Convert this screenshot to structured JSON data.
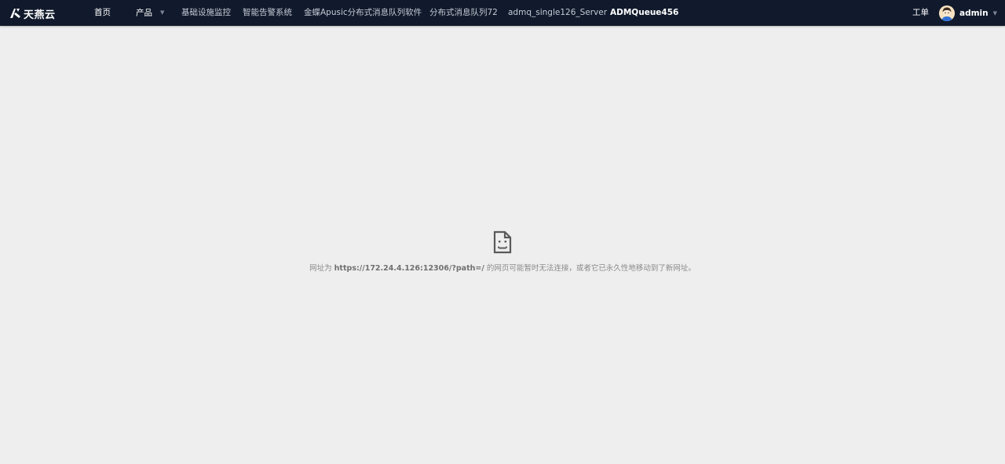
{
  "brand": {
    "name": "天燕云",
    "logo_icon": "tianyan-logo-icon"
  },
  "nav": {
    "items": [
      {
        "label": "首页"
      },
      {
        "label": "产品",
        "has_dropdown": true
      },
      {
        "label": "基础设施监控"
      },
      {
        "label": "智能告警系统"
      },
      {
        "label": "金蝶Apusic分布式消息队列软件"
      },
      {
        "label": "分布式消息队列72"
      },
      {
        "label": "admq_single126_Server"
      },
      {
        "label": "ADMQueue456"
      }
    ]
  },
  "header_right": {
    "ticket_label": "工单",
    "user_name": "admin"
  },
  "error": {
    "icon": "sad-page-icon",
    "prefix": "网址为",
    "url": "https://172.24.4.126:12306/?path=/",
    "suffix": "的网页可能暂时无法连接，或者它已永久性地移动到了新网址。"
  },
  "colors": {
    "topbar_bg": "#111a2c",
    "page_bg": "#eeeeee",
    "error_text": "#8a8a8a"
  }
}
